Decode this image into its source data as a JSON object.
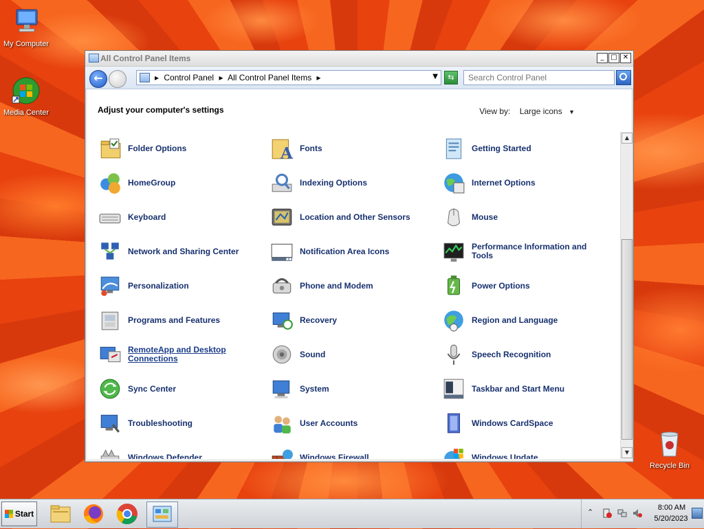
{
  "desktop": {
    "icons": [
      {
        "label": "My Computer"
      },
      {
        "label": "Media Center"
      },
      {
        "label": "Recycle Bin"
      }
    ]
  },
  "window": {
    "title": "All Control Panel Items",
    "caption_buttons": {
      "minimize": "_",
      "maximize": "□",
      "close": "✕"
    },
    "breadcrumbs": [
      "Control Panel",
      "All Control Panel Items"
    ],
    "search_placeholder": "Search Control Panel",
    "heading": "Adjust your computer's settings",
    "view_by_label": "View by:",
    "view_by_value": "Large icons"
  },
  "items": [
    {
      "label": "Folder Options",
      "icon": "folder-options-icon"
    },
    {
      "label": "Fonts",
      "icon": "fonts-icon"
    },
    {
      "label": "Getting Started",
      "icon": "getting-started-icon"
    },
    {
      "label": "HomeGroup",
      "icon": "homegroup-icon"
    },
    {
      "label": "Indexing Options",
      "icon": "indexing-options-icon"
    },
    {
      "label": "Internet Options",
      "icon": "internet-options-icon"
    },
    {
      "label": "Keyboard",
      "icon": "keyboard-icon"
    },
    {
      "label": "Location and Other Sensors",
      "icon": "location-sensors-icon"
    },
    {
      "label": "Mouse",
      "icon": "mouse-icon"
    },
    {
      "label": "Network and Sharing Center",
      "icon": "network-sharing-icon"
    },
    {
      "label": "Notification Area Icons",
      "icon": "notification-area-icon"
    },
    {
      "label": "Performance Information and Tools",
      "icon": "performance-icon"
    },
    {
      "label": "Personalization",
      "icon": "personalization-icon"
    },
    {
      "label": "Phone and Modem",
      "icon": "phone-modem-icon"
    },
    {
      "label": "Power Options",
      "icon": "power-options-icon"
    },
    {
      "label": "Programs and Features",
      "icon": "programs-features-icon"
    },
    {
      "label": "Recovery",
      "icon": "recovery-icon"
    },
    {
      "label": "Region and Language",
      "icon": "region-language-icon"
    },
    {
      "label": "RemoteApp and Desktop Connections",
      "icon": "remoteapp-icon"
    },
    {
      "label": "Sound",
      "icon": "sound-icon"
    },
    {
      "label": "Speech Recognition",
      "icon": "speech-recognition-icon"
    },
    {
      "label": "Sync Center",
      "icon": "sync-center-icon"
    },
    {
      "label": "System",
      "icon": "system-icon"
    },
    {
      "label": "Taskbar and Start Menu",
      "icon": "taskbar-start-menu-icon"
    },
    {
      "label": "Troubleshooting",
      "icon": "troubleshooting-icon"
    },
    {
      "label": "User Accounts",
      "icon": "user-accounts-icon"
    },
    {
      "label": "Windows CardSpace",
      "icon": "cardspace-icon"
    },
    {
      "label": "Windows Defender",
      "icon": "defender-icon"
    },
    {
      "label": "Windows Firewall",
      "icon": "firewall-icon"
    },
    {
      "label": "Windows Update",
      "icon": "windows-update-icon"
    }
  ],
  "taskbar": {
    "start_label": "Start",
    "apps": [
      "file-explorer-icon",
      "firefox-icon",
      "chrome-icon",
      "control-panel-icon"
    ],
    "clock": {
      "time": "8:00 AM",
      "date": "5/20/2023"
    }
  }
}
